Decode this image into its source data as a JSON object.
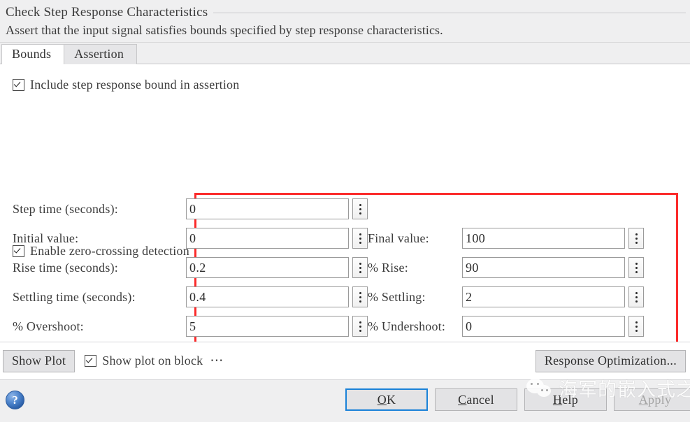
{
  "header": {
    "title": "Check Step Response Characteristics",
    "description": "Assert that the input signal satisfies bounds specified by step response characteristics."
  },
  "tabs": [
    {
      "label": "Bounds",
      "active": true
    },
    {
      "label": "Assertion",
      "active": false
    }
  ],
  "options": {
    "include_bound": {
      "label": "Include step response bound in assertion",
      "checked": true
    },
    "zero_crossing": {
      "label": "Enable zero-crossing detection",
      "checked": true
    },
    "show_plot_on_block": {
      "label": "Show plot on block",
      "checked": true
    }
  },
  "fields": [
    {
      "left_label": "Step time (seconds):",
      "left_value": "0",
      "right_label": "",
      "right_value": ""
    },
    {
      "left_label": "Initial value:",
      "left_value": "0",
      "right_label": "Final value:",
      "right_value": "100"
    },
    {
      "left_label": "Rise time (seconds):",
      "left_value": "0.2",
      "right_label": "% Rise:",
      "right_value": "90"
    },
    {
      "left_label": "Settling time (seconds):",
      "left_value": "0.4",
      "right_label": "% Settling:",
      "right_value": "2"
    },
    {
      "left_label": "% Overshoot:",
      "left_value": "5",
      "right_label": "% Undershoot:",
      "right_value": "0"
    }
  ],
  "toolbar": {
    "show_plot_label": "Show Plot",
    "more_options_label": "⋯",
    "response_optimization_label": "Response Optimization..."
  },
  "footer": {
    "help_icon_label": "?",
    "ok_label": "OK",
    "cancel_label": "Cancel",
    "help_label": "Help",
    "apply_label": "Apply"
  },
  "watermark": {
    "text": "海军的嵌入式之旅"
  },
  "colors": {
    "highlight_box": "#fb2b2b",
    "focus_border": "#1a82d8",
    "header_bg": "#efeff0"
  }
}
